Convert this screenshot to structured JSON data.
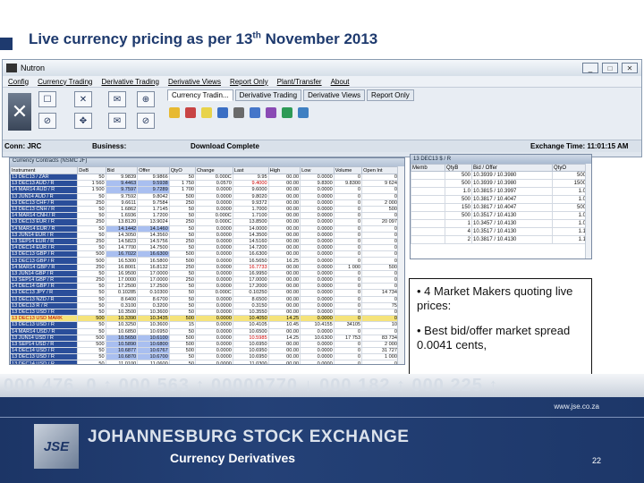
{
  "slide": {
    "title_main": "Live currency pricing as per 13",
    "title_sup": "th",
    "title_end": " November 2013",
    "url": "www.jse.co.za",
    "page_number": "22",
    "logo_text": "JSE",
    "exchange_name": "JOHANNESBURG STOCK EXCHANGE",
    "division": "Currency Derivatives",
    "ticker": "000 476. 0 ↑  000 563 ↑  00000770 ↓  000 182 ↑  000 225 ↑"
  },
  "callout": {
    "bullet1": "• 4 Market Makers quoting live prices:",
    "bullet2": "• Best bid/offer market spread 0.0041 cents,"
  },
  "app": {
    "window_title": "Nutron",
    "menu": [
      "Config",
      "Currency Trading",
      "Derivative Trading",
      "Derivative Views",
      "Report Only",
      "Plant/Transfer",
      "About"
    ],
    "tabs": [
      "Currency Tradin...",
      "Derivative Trading",
      "Derivative Views",
      "Report Only"
    ],
    "status": {
      "conn": "Conn: JRC",
      "business": "Business:",
      "download": "Download Complete",
      "exchange_time": "Exchange Time: 11:01:15 AM"
    },
    "icon_colors": [
      "#e7b932",
      "#c84444",
      "#e8d34a",
      "#3b6fc4",
      "#6a6a6a",
      "#4576c9",
      "#8a4ab4",
      "#2e9a56",
      "#3f80c2"
    ]
  },
  "grid": {
    "window_title": "Currency Contracts (NSMC JF)",
    "headers": [
      "Instrument",
      "DeB",
      "Bid",
      "Offer",
      "QtyO",
      "Change",
      "Last",
      "High",
      "Low",
      "Volume",
      "Open Int"
    ],
    "rows": [
      [
        "13 DEC13 / ZAR",
        "50",
        "9.9839",
        "9.9866",
        "50",
        "0.000C",
        "9.95",
        "00.00",
        "0.0000",
        "0",
        "0"
      ],
      [
        "13 DEC13 AUD / R",
        "1 560",
        "9.4463",
        "9.5938",
        "1 750",
        "0.0570",
        "9.4000",
        "00.00",
        "9.8300",
        "9.8300",
        "9 624"
      ],
      [
        "14 MAR14 AUD / R",
        "1 500",
        "9.7597",
        "9.7289",
        "1 700",
        "0.0000",
        "9.6000",
        "00.00",
        "0.0000",
        "0",
        "0"
      ],
      [
        "13 JUN14 AUD / R",
        "50",
        "9.7592",
        "9.8042",
        "500",
        "0.0000",
        "9.8020",
        "00.00",
        "0.0000",
        "0",
        "0"
      ],
      [
        "13 DEC13 CHF / R",
        "250",
        "9.6611",
        "9.7584",
        "250",
        "0.0000",
        "9.9372",
        "00.00",
        "0.0000",
        "0",
        "2 000"
      ],
      [
        "13 DEC13 CNH / R",
        "50",
        "1.6862",
        "1.7145",
        "50",
        "0.0000",
        "1.7000",
        "00.00",
        "0.0000",
        "0",
        "500"
      ],
      [
        "14 MAR14 CNH / R",
        "50",
        "1.6936",
        "1.7200",
        "50",
        "0.000C",
        "1.7100",
        "00.00",
        "0.0000",
        "0",
        "0"
      ],
      [
        "13 DEC13 EUR / R",
        "250",
        "13.8120",
        "13.9024",
        "250",
        "0.000C",
        "13.8500",
        "00.00",
        "0.0000",
        "0",
        "20 097"
      ],
      [
        "14 MAR14 EUR / R",
        "50",
        "14.1442",
        "14.1460",
        "50",
        "0.0000",
        "14.0000",
        "00.00",
        "0.0000",
        "0",
        "0"
      ],
      [
        "13 JUN14 EUR / R",
        "50",
        "14.3050",
        "14.3560",
        "50",
        "0.0000",
        "14.3500",
        "00.00",
        "0.0000",
        "0",
        "0"
      ],
      [
        "13 SEP14 EUR / R",
        "250",
        "14.5823",
        "14.5756",
        "250",
        "0.0000",
        "14.5160",
        "00.00",
        "0.0000",
        "0",
        "0"
      ],
      [
        "14 DEC14 EUR / R",
        "50",
        "14.7700",
        "14.7500",
        "50",
        "0.0000",
        "14.7200",
        "00.00",
        "0.0000",
        "0",
        "0"
      ],
      [
        "13 DEC13 GBP / R",
        "500",
        "16.7022",
        "16.6300",
        "500",
        "0.0000",
        "16.6300",
        "00.00",
        "0.0000",
        "0",
        "0"
      ],
      [
        "13 DEC13 GBP / R",
        "500",
        "16.5300",
        "16.5800",
        "500",
        "0.0000",
        "16.5650",
        "16.25",
        "0.0000",
        "0",
        "0"
      ],
      [
        "14 MAR14 GBP / R",
        "250",
        "16.8001",
        "16.8132",
        "250",
        "0.0000",
        "16.7733",
        "00.00",
        "0.0000",
        "1 000",
        "500"
      ],
      [
        "13 JUN14 GBP / R",
        "50",
        "16.9500",
        "17.0000",
        "50",
        "0.0000",
        "16.9950",
        "00.00",
        "0.0000",
        "0",
        "0"
      ],
      [
        "13 SEP14 GBP / R",
        "250",
        "17.0000",
        "17.0000",
        "250",
        "0.0000",
        "17.0000",
        "00.00",
        "0.0000",
        "0",
        "0"
      ],
      [
        "14 DEC14 GBP / R",
        "50",
        "17.2500",
        "17.2500",
        "50",
        "0.0000",
        "17.2000",
        "00.00",
        "0.0000",
        "0",
        "0"
      ],
      [
        "13 DEC13 JPY / R",
        "50",
        "0.10285",
        "0.10300",
        "50",
        "0.000C",
        "0.10250",
        "00.00",
        "0.0000",
        "0",
        "14 734"
      ],
      [
        "13 DEC13 NZD / R",
        "50",
        "8.6400",
        "8.6700",
        "50",
        "0.0000",
        "8.6500",
        "00.00",
        "0.0000",
        "0",
        "0"
      ],
      [
        "13 DEC13 R / R",
        "50",
        "0.3100",
        "0.3200",
        "50",
        "0.0000",
        "0.3150",
        "00.00",
        "0.0000",
        "0",
        "75"
      ],
      [
        "13 DEC13 USD / R",
        "50",
        "10.3500",
        "10.3600",
        "50",
        "0.0000",
        "10.3550",
        "00.00",
        "0.0000",
        "0",
        "0"
      ],
      [
        "13 DEC13 USD MARK",
        "500",
        "10.3390",
        "10.3435",
        "500",
        "0.0000",
        "10.4050",
        "14.25",
        "0.0000",
        "0",
        "0"
      ],
      [
        "13 DEC13 USD / R",
        "50",
        "10.3250",
        "10.3600",
        "15",
        "0.0000",
        "10.4105",
        "10.45",
        "10.4155",
        "34105",
        "10"
      ],
      [
        "14 MAR14 USD / R",
        "50",
        "10.6850",
        "10.6950",
        "50",
        "0.0000",
        "10.6500",
        "00.00",
        "0.0000",
        "0",
        "0"
      ],
      [
        "13 JUN14 USD / R",
        "500",
        "10.5650",
        "10.6100",
        "500",
        "0.0000",
        "10.5985",
        "14.25",
        "10.6300",
        "17 753",
        "83 734"
      ],
      [
        "13 SEP14 USD / R",
        "500",
        "10.5890",
        "10.6800",
        "500",
        "0.0000",
        "10.6950",
        "00.00",
        "0.0000",
        "0",
        "2 000"
      ],
      [
        "14 DEC14 USD / R",
        "50",
        "10.6877",
        "10.6767",
        "500",
        "0.0000",
        "10.6950",
        "00.00",
        "0.0000",
        "0",
        "31 727"
      ],
      [
        "13 DEC13 USD / R",
        "50",
        "10.6870",
        "10.6700",
        "50",
        "0.0000",
        "10.6950",
        "00.00",
        "0.0000",
        "0",
        "1 000"
      ],
      [
        "13 DEC14 USD / R",
        "50",
        "11.0100",
        "11.0600",
        "50",
        "0.0000",
        "11.0300",
        "00.00",
        "0.0000",
        "0",
        "0"
      ]
    ]
  },
  "mm": {
    "window_title": "13 DEC13 $ / R",
    "headers": [
      "Memb",
      "QtyB",
      "Bid / Offer",
      "QtyO"
    ],
    "rows": [
      [
        "",
        "500",
        "10.3939 / 10.3980",
        "500"
      ],
      [
        "",
        "500",
        "10.3939 / 10.3980",
        "1500"
      ],
      [
        "",
        "1.0",
        "10.3815 / 10.3997",
        "1.0"
      ],
      [
        "",
        "500",
        "10.3817 / 10.4047",
        "1.0"
      ],
      [
        "",
        "150",
        "10.3817 / 10.4047",
        "500"
      ],
      [
        "",
        "500",
        "10.3517 / 10.4130",
        "1.0"
      ],
      [
        "",
        "1",
        "10.3457 / 10.4130",
        "1.0"
      ],
      [
        "",
        "4",
        "10.3517 / 10.4130",
        "1.1"
      ],
      [
        "",
        "2",
        "10.3817 / 10.4130",
        "1.1"
      ]
    ]
  }
}
